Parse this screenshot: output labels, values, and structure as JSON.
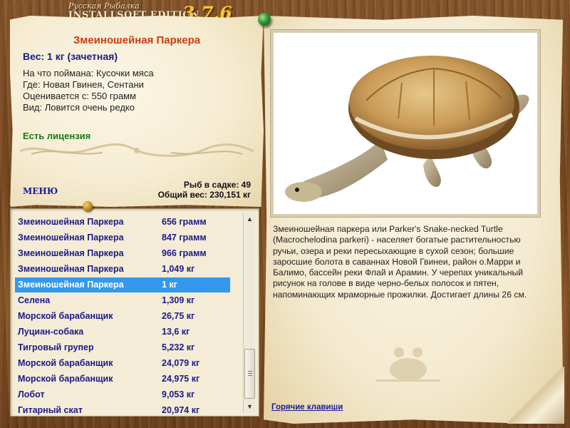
{
  "app": {
    "title_line1": "Русская Рыбалка",
    "title_line2": "INSTALLSOFT EDITION",
    "version": "3.7.6"
  },
  "catch": {
    "fish_name": "Змеиношейная Паркера",
    "weight": "Вес: 1 кг (зачетная)",
    "bait": "На что поймана: Кусочки мяса",
    "location": "Где: Новая Гвинея, Сентани",
    "valued_from": "Оценивается с: 550 грамм",
    "rarity": "Вид: Ловится очень редко",
    "license": "Есть лицензия"
  },
  "menu_label": "МЕНЮ",
  "stats": {
    "fish_in_keepnet": "Рыб в садке: 49",
    "total_weight": "Общий вес: 230,151 кг"
  },
  "list": {
    "selected_index": 4,
    "rows": [
      {
        "name": "Змеиношейная Паркера",
        "weight": "656 грамм"
      },
      {
        "name": "Змеиношейная Паркера",
        "weight": "847 грамм"
      },
      {
        "name": "Змеиношейная Паркера",
        "weight": "966 грамм"
      },
      {
        "name": "Змеиношейная Паркера",
        "weight": "1,049 кг"
      },
      {
        "name": "Змеиношейная Паркера",
        "weight": "1 кг"
      },
      {
        "name": "Селена",
        "weight": "1,309 кг"
      },
      {
        "name": "Морской барабанщик",
        "weight": "26,75 кг"
      },
      {
        "name": "Луциан-собака",
        "weight": "13,6 кг"
      },
      {
        "name": "Тигровый групер",
        "weight": "5,232 кг"
      },
      {
        "name": "Морской барабанщик",
        "weight": "24,079 кг"
      },
      {
        "name": "Морской барабанщик",
        "weight": "24,975 кг"
      },
      {
        "name": "Лобот",
        "weight": "9,053 кг"
      },
      {
        "name": "Гитарный скат",
        "weight": "20,974 кг"
      }
    ]
  },
  "description": "Змеиношейная паркера или Parker's Snake-necked Turtle (Macrochelodina parkeri) - населяет богатые растительностью ручьи, озера и реки пересыхающие в сухой сезон; большие заросшие болота в саваннах Новой Гвинеи, район о.Марри и Балимо, бассейн реки Флай и Арамин. У черепах уникальный рисунок на голове в виде черно-белых полосок и пятен, напоминающих мраморные прожилки. Достигает длины 26 см.",
  "hotkeys_label": "Горячие клавиши",
  "colors": {
    "fish_name": "#c83c10",
    "link_blue": "#1a1a8a",
    "selection": "#3398ee",
    "license_green": "#1a7a1a",
    "version_gold": "#f2c640"
  },
  "icons": {
    "scroll_up": "▲",
    "scroll_down": "▼"
  }
}
